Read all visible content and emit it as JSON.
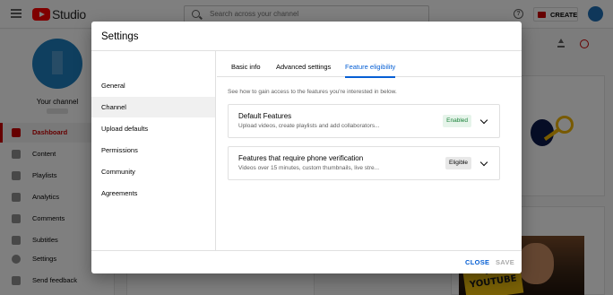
{
  "header": {
    "app_name": "Studio",
    "search_placeholder": "Search across your channel",
    "create_label": "CREATE"
  },
  "sidebar": {
    "channel_label": "Your channel",
    "items": [
      {
        "label": "Dashboard",
        "icon": "dashboard-icon",
        "active": true
      },
      {
        "label": "Content",
        "icon": "content-icon"
      },
      {
        "label": "Playlists",
        "icon": "playlists-icon"
      },
      {
        "label": "Analytics",
        "icon": "analytics-icon"
      },
      {
        "label": "Comments",
        "icon": "comments-icon"
      },
      {
        "label": "Subtitles",
        "icon": "subtitles-icon"
      },
      {
        "label": "Settings",
        "icon": "gear-icon"
      },
      {
        "label": "Send feedback",
        "icon": "feedback-icon"
      }
    ]
  },
  "background_thumbnail_text": "AT\nYOUTUBE",
  "dialog": {
    "title": "Settings",
    "nav": [
      {
        "label": "General"
      },
      {
        "label": "Channel",
        "active": true
      },
      {
        "label": "Upload defaults"
      },
      {
        "label": "Permissions"
      },
      {
        "label": "Community"
      },
      {
        "label": "Agreements"
      }
    ],
    "tabs": [
      {
        "label": "Basic info"
      },
      {
        "label": "Advanced settings"
      },
      {
        "label": "Feature eligibility",
        "active": true
      }
    ],
    "intro": "See how to gain access to the features you're interested in below.",
    "features": [
      {
        "title": "Default Features",
        "description": "Upload videos, create playlists and add collaborators...",
        "status": "Enabled"
      },
      {
        "title": "Features that require phone verification",
        "description": "Videos over 15 minutes, custom thumbnails, live stre...",
        "status": "Eligible"
      }
    ],
    "close_label": "CLOSE",
    "save_label": "SAVE"
  },
  "colors": {
    "accent_blue": "#065fd4",
    "brand_red": "#cc0000",
    "enabled_green": "#188038"
  }
}
